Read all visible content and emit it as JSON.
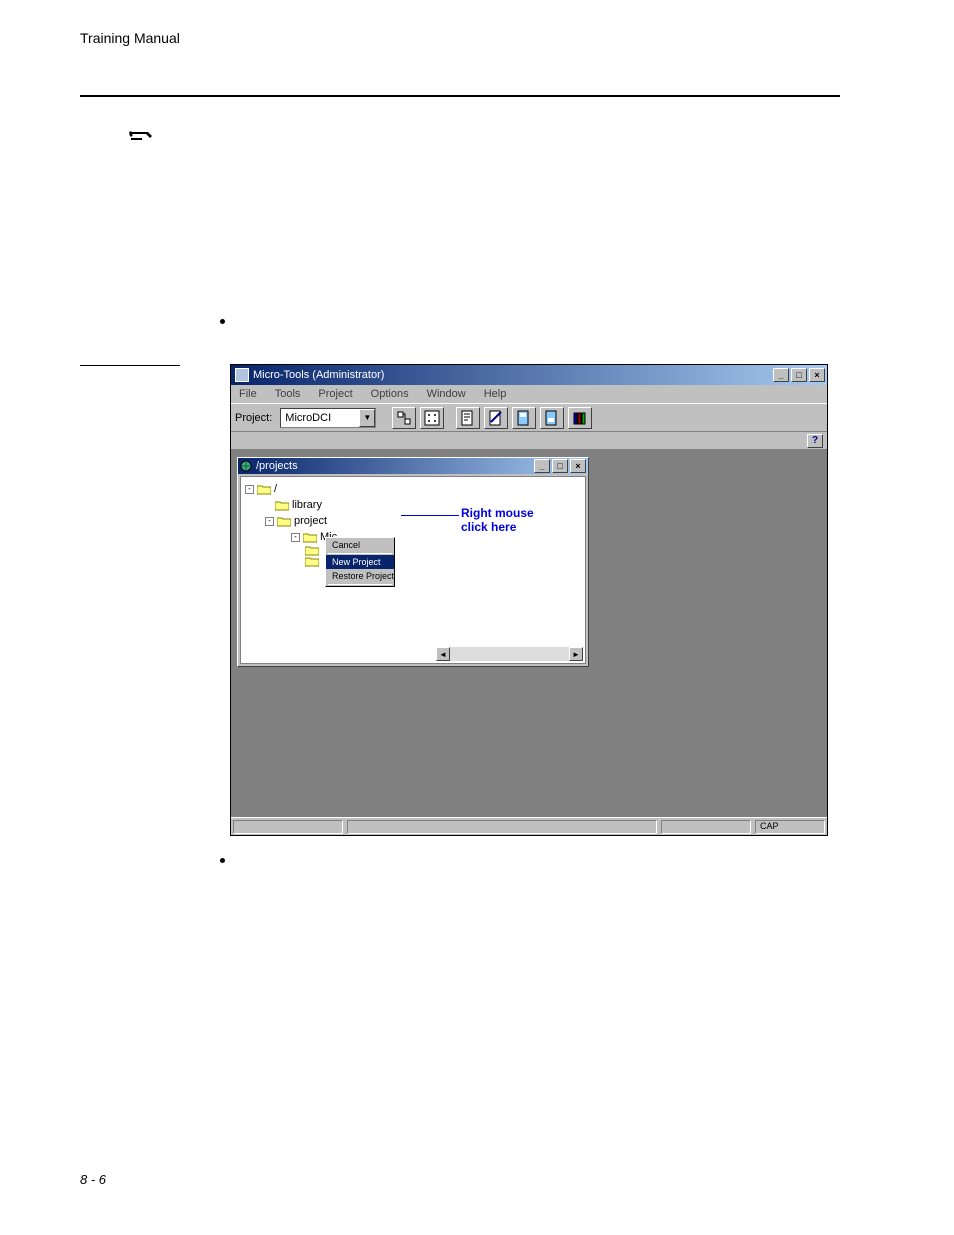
{
  "header": "Training Manual",
  "footer": "8 - 6",
  "app": {
    "title": "Micro-Tools (Administrator)",
    "menu": [
      "File",
      "Tools",
      "Project",
      "Options",
      "Window",
      "Help"
    ],
    "toolbar": {
      "label": "Project:",
      "project": "MicroDCI"
    },
    "inner_title": "/projects",
    "tree": {
      "root": "/",
      "items": [
        "library",
        "project",
        "Mic"
      ]
    },
    "context_menu": {
      "items": [
        "Cancel",
        "New Project",
        "Restore Project"
      ]
    },
    "annotation": {
      "line1": "Right mouse",
      "line2": "click here"
    },
    "status_caps": "CAP"
  }
}
